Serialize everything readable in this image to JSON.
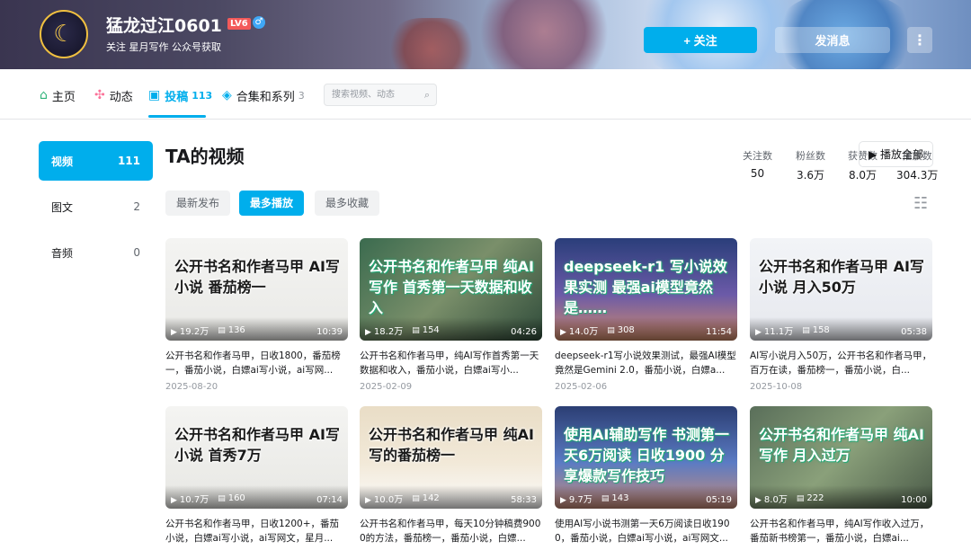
{
  "user": {
    "name": "猛龙过江0601",
    "level": "LV6",
    "gender": "♂",
    "sign": "关注 星月写作 公众号获取"
  },
  "actions": {
    "follow": "+ 关注",
    "message": "发消息",
    "more": "⋮"
  },
  "tabs": [
    {
      "label": "主页",
      "count": "",
      "icon": "⌂"
    },
    {
      "label": "动态",
      "count": "",
      "icon": "✣"
    },
    {
      "label": "投稿",
      "count": "113",
      "icon": "▣"
    },
    {
      "label": "合集和系列",
      "count": "3",
      "icon": "◈"
    }
  ],
  "search": {
    "placeholder": "搜索视频、动态"
  },
  "stats": [
    {
      "label": "关注数",
      "value": "50"
    },
    {
      "label": "粉丝数",
      "value": "3.6万"
    },
    {
      "label": "获赞数",
      "value": "8.0万"
    },
    {
      "label": "播放数",
      "value": "304.3万"
    }
  ],
  "sidebar": [
    {
      "label": "视频",
      "count": "111"
    },
    {
      "label": "图文",
      "count": "2"
    },
    {
      "label": "音频",
      "count": "0"
    }
  ],
  "section": {
    "title": "TA的视频",
    "play_all": "▶ 播放全部"
  },
  "filters": [
    "最新发布",
    "最多播放",
    "最多收藏"
  ],
  "videos": [
    {
      "thumb_text": "公开书名和作者马甲 AI写小说 番茄榜一",
      "plays": "19.2万",
      "danmaku": "136",
      "duration": "10:39",
      "title": "公开书名和作者马甲，日收1800，番茄榜一，番茄小说，白嫖ai写小说，ai写网...",
      "date": "2025-08-20"
    },
    {
      "thumb_text": "公开书名和作者马甲 纯AI写作 首秀第一天数据和收入",
      "plays": "18.2万",
      "danmaku": "154",
      "duration": "04:26",
      "title": "公开书名和作者马甲，纯AI写作首秀第一天数据和收入，番茄小说，白嫖ai写小...",
      "date": "2025-02-09"
    },
    {
      "thumb_text": "deepseek-r1 写小说效果实测 最强ai模型竟然是……",
      "plays": "14.0万",
      "danmaku": "308",
      "duration": "11:54",
      "title": "deepseek-r1写小说效果测试，最强AI模型竟然是Gemini 2.0，番茄小说，白嫖a...",
      "date": "2025-02-06"
    },
    {
      "thumb_text": "公开书名和作者马甲 AI写小说 月入50万",
      "plays": "11.1万",
      "danmaku": "158",
      "duration": "05:38",
      "title": "AI写小说月入50万，公开书名和作者马甲，百万在读，番茄榜一，番茄小说，白...",
      "date": "2025-10-08"
    },
    {
      "thumb_text": "公开书名和作者马甲 AI写小说 首秀7万",
      "plays": "10.7万",
      "danmaku": "160",
      "duration": "07:14",
      "title": "公开书名和作者马甲，日收1200+，番茄小说，白嫖ai写小说，ai写网文，星月...",
      "date": ""
    },
    {
      "thumb_text": "公开书名和作者马甲 纯AI写的番茄榜一",
      "plays": "10.0万",
      "danmaku": "142",
      "duration": "58:33",
      "title": "公开书名和作者马甲，每天10分钟稿费9000的方法，番茄榜一，番茄小说，白嫖...",
      "date": ""
    },
    {
      "thumb_text": "使用AI辅助写作 书测第一天6万阅读 日收1900 分享爆款写作技巧",
      "plays": "9.7万",
      "danmaku": "143",
      "duration": "05:19",
      "title": "使用AI写小说书测第一天6万阅读日收1900，番茄小说，白嫖ai写小说，ai写网文...",
      "date": ""
    },
    {
      "thumb_text": "公开书名和作者马甲 纯AI写作 月入过万",
      "plays": "8.0万",
      "danmaku": "222",
      "duration": "10:00",
      "title": "公开书名和作者马甲，纯AI写作收入过万，番茄新书榜第一，番茄小说，白嫖ai...",
      "date": ""
    }
  ]
}
